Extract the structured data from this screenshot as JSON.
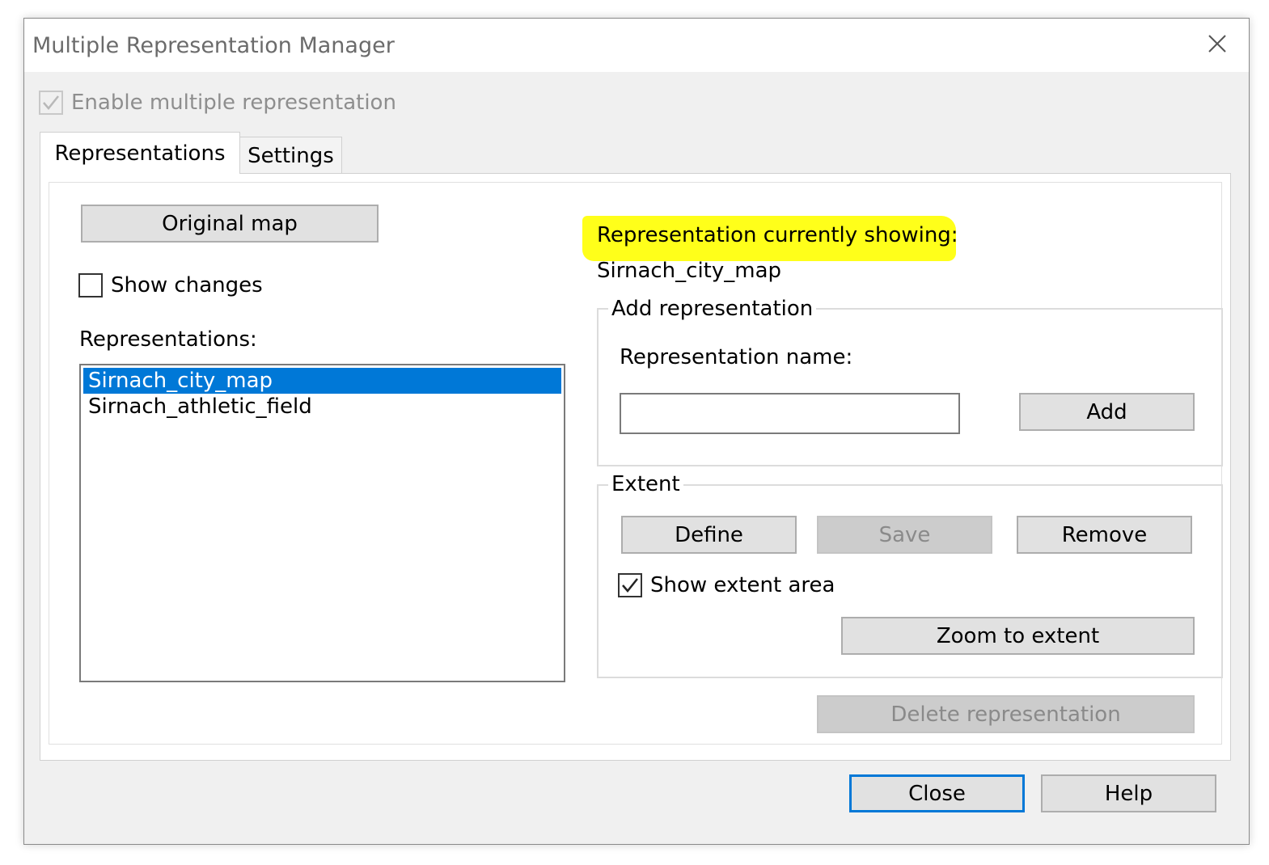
{
  "window": {
    "title": "Multiple Representation Manager"
  },
  "enable": {
    "label": "Enable multiple representation",
    "checked": true
  },
  "tabs": [
    {
      "label": "Representations",
      "active": true
    },
    {
      "label": "Settings",
      "active": false
    }
  ],
  "left": {
    "original_map_label": "Original map",
    "show_changes_label": "Show changes",
    "representations_label": "Representations:",
    "list_items": [
      {
        "label": "Sirnach_city_map",
        "selected": true
      },
      {
        "label": "Sirnach_athletic_field",
        "selected": false
      }
    ]
  },
  "right": {
    "current_heading": "Representation currently showing:",
    "current_value": "Sirnach_city_map",
    "highlight_color": "#ffff1a",
    "add_group": {
      "legend": "Add representation",
      "name_label": "Representation name:",
      "name_value": "",
      "add_label": "Add"
    },
    "extent_group": {
      "legend": "Extent",
      "define_label": "Define",
      "save_label": "Save",
      "remove_label": "Remove",
      "show_extent_label": "Show extent area",
      "show_extent_checked": true,
      "zoom_label": "Zoom to extent"
    },
    "delete_label": "Delete representation"
  },
  "footer": {
    "close_label": "Close",
    "help_label": "Help"
  },
  "colors": {
    "selection": "#0078d7",
    "default_button_border": "#0078d7"
  },
  "icons": {
    "close": "close-icon",
    "check": "checkmark-icon"
  }
}
